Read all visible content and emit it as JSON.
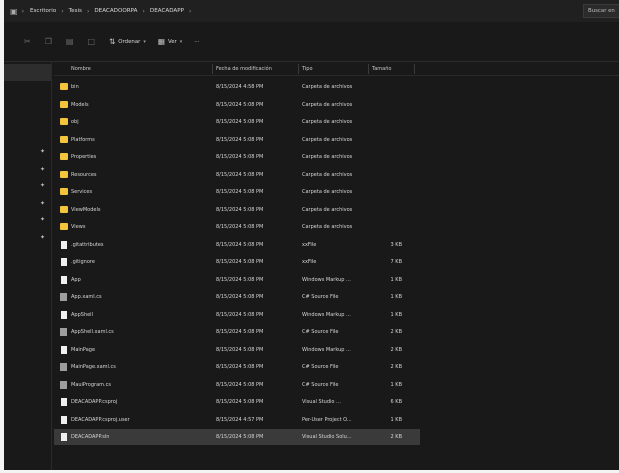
{
  "address": {
    "breadcrumbs": [
      "Escritorio",
      "Tesis",
      "DEACADOORPA",
      "DEACADAPP"
    ],
    "search_placeholder": "Buscar en"
  },
  "commands": {
    "sort_label": "Ordenar",
    "view_label": "Ver",
    "more_label": "···"
  },
  "columns": {
    "name": "Nombre",
    "date": "Fecha de modificación",
    "type": "Tipo",
    "size": "Tamaño"
  },
  "files": [
    {
      "name": "bin",
      "date": "8/15/2024 4:58 PM",
      "type": "Carpeta de archivos",
      "size": "",
      "icon": "folder"
    },
    {
      "name": "Models",
      "date": "8/15/2024 5:08 PM",
      "type": "Carpeta de archivos",
      "size": "",
      "icon": "folder"
    },
    {
      "name": "obj",
      "date": "8/15/2024 5:08 PM",
      "type": "Carpeta de archivos",
      "size": "",
      "icon": "folder"
    },
    {
      "name": "Platforms",
      "date": "8/15/2024 5:08 PM",
      "type": "Carpeta de archivos",
      "size": "",
      "icon": "folder"
    },
    {
      "name": "Properties",
      "date": "8/15/2024 5:08 PM",
      "type": "Carpeta de archivos",
      "size": "",
      "icon": "folder"
    },
    {
      "name": "Resources",
      "date": "8/15/2024 5:08 PM",
      "type": "Carpeta de archivos",
      "size": "",
      "icon": "folder"
    },
    {
      "name": "Services",
      "date": "8/15/2024 5:08 PM",
      "type": "Carpeta de archivos",
      "size": "",
      "icon": "folder"
    },
    {
      "name": "ViewModels",
      "date": "8/15/2024 5:08 PM",
      "type": "Carpeta de archivos",
      "size": "",
      "icon": "folder"
    },
    {
      "name": "Views",
      "date": "8/15/2024 5:08 PM",
      "type": "Carpeta de archivos",
      "size": "",
      "icon": "folder"
    },
    {
      "name": ".gitattributes",
      "date": "8/15/2024 5:08 PM",
      "type": "xxFile",
      "size": "3 KB",
      "icon": "file"
    },
    {
      "name": ".gitignore",
      "date": "8/15/2024 5:08 PM",
      "type": "xxFile",
      "size": "7 KB",
      "icon": "file"
    },
    {
      "name": "App",
      "date": "8/15/2024 5:08 PM",
      "type": "Windows Markup ...",
      "size": "1 KB",
      "icon": "file"
    },
    {
      "name": "App.xaml.cs",
      "date": "8/15/2024 5:08 PM",
      "type": "C# Source File",
      "size": "1 KB",
      "icon": "cs"
    },
    {
      "name": "AppShell",
      "date": "8/15/2024 5:08 PM",
      "type": "Windows Markup ...",
      "size": "1 KB",
      "icon": "file"
    },
    {
      "name": "AppShell.xaml.cs",
      "date": "8/15/2024 5:08 PM",
      "type": "C# Source File",
      "size": "2 KB",
      "icon": "cs"
    },
    {
      "name": "MainPage",
      "date": "8/15/2024 5:08 PM",
      "type": "Windows Markup ...",
      "size": "2 KB",
      "icon": "file"
    },
    {
      "name": "MainPage.xaml.cs",
      "date": "8/15/2024 5:08 PM",
      "type": "C# Source File",
      "size": "2 KB",
      "icon": "cs"
    },
    {
      "name": "MauiProgram.cs",
      "date": "8/15/2024 5:08 PM",
      "type": "C# Source File",
      "size": "1 KB",
      "icon": "cs"
    },
    {
      "name": "DEACADAPP.csproj",
      "date": "8/15/2024 5:08 PM",
      "type": "Visual Studio ...",
      "size": "6 KB",
      "icon": "file"
    },
    {
      "name": "DEACADAPP.csproj.user",
      "date": "8/15/2024 4:57 PM",
      "type": "Per-User Project O...",
      "size": "1 KB",
      "icon": "file"
    },
    {
      "name": "DEACADAPP.sln",
      "date": "8/15/2024 5:08 PM",
      "type": "Visual Studio Solu...",
      "size": "2 KB",
      "icon": "file"
    }
  ]
}
